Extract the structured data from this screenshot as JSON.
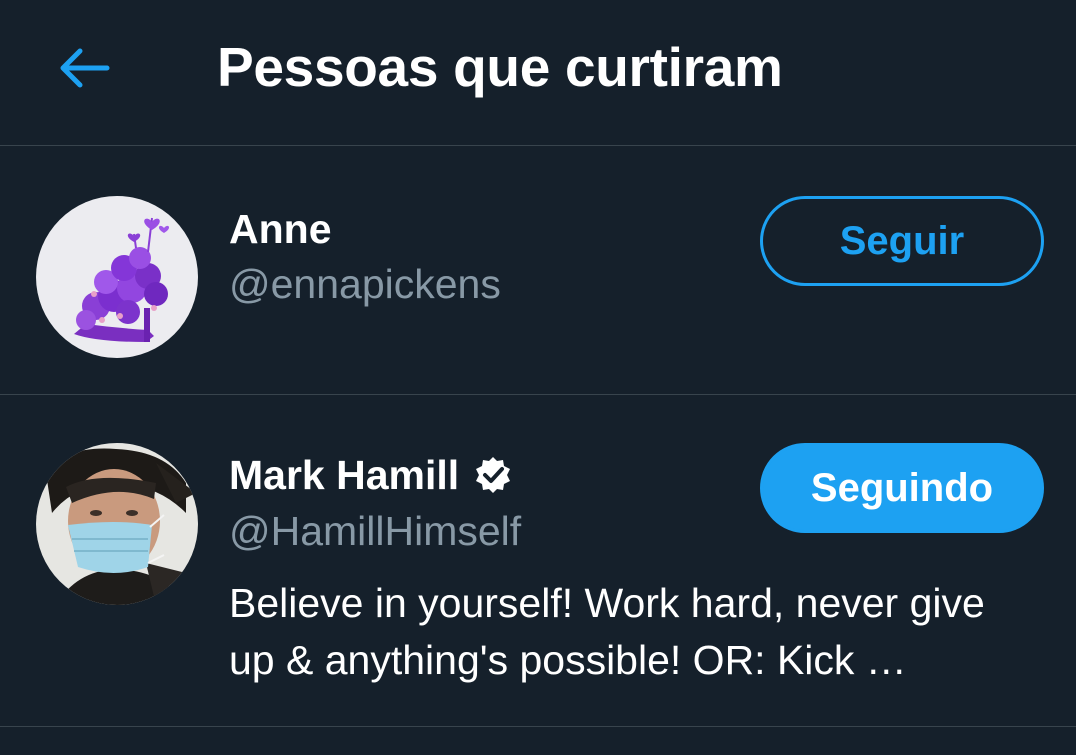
{
  "header": {
    "title": "Pessoas que curtiram",
    "back_icon": "arrow-left-icon"
  },
  "colors": {
    "background": "#15202b",
    "accent": "#1da1f2",
    "divider": "#38444d",
    "secondary_text": "#8899a6"
  },
  "users": [
    {
      "name": "Anne",
      "handle": "@ennapickens",
      "verified": false,
      "follow_label": "Seguir",
      "following": false,
      "bio": ""
    },
    {
      "name": "Mark Hamill",
      "handle": "@HamillHimself",
      "verified": true,
      "follow_label": "Seguindo",
      "following": true,
      "bio": "Believe in yourself! Work hard, never give up & anything's possible! OR: Kick …"
    }
  ]
}
